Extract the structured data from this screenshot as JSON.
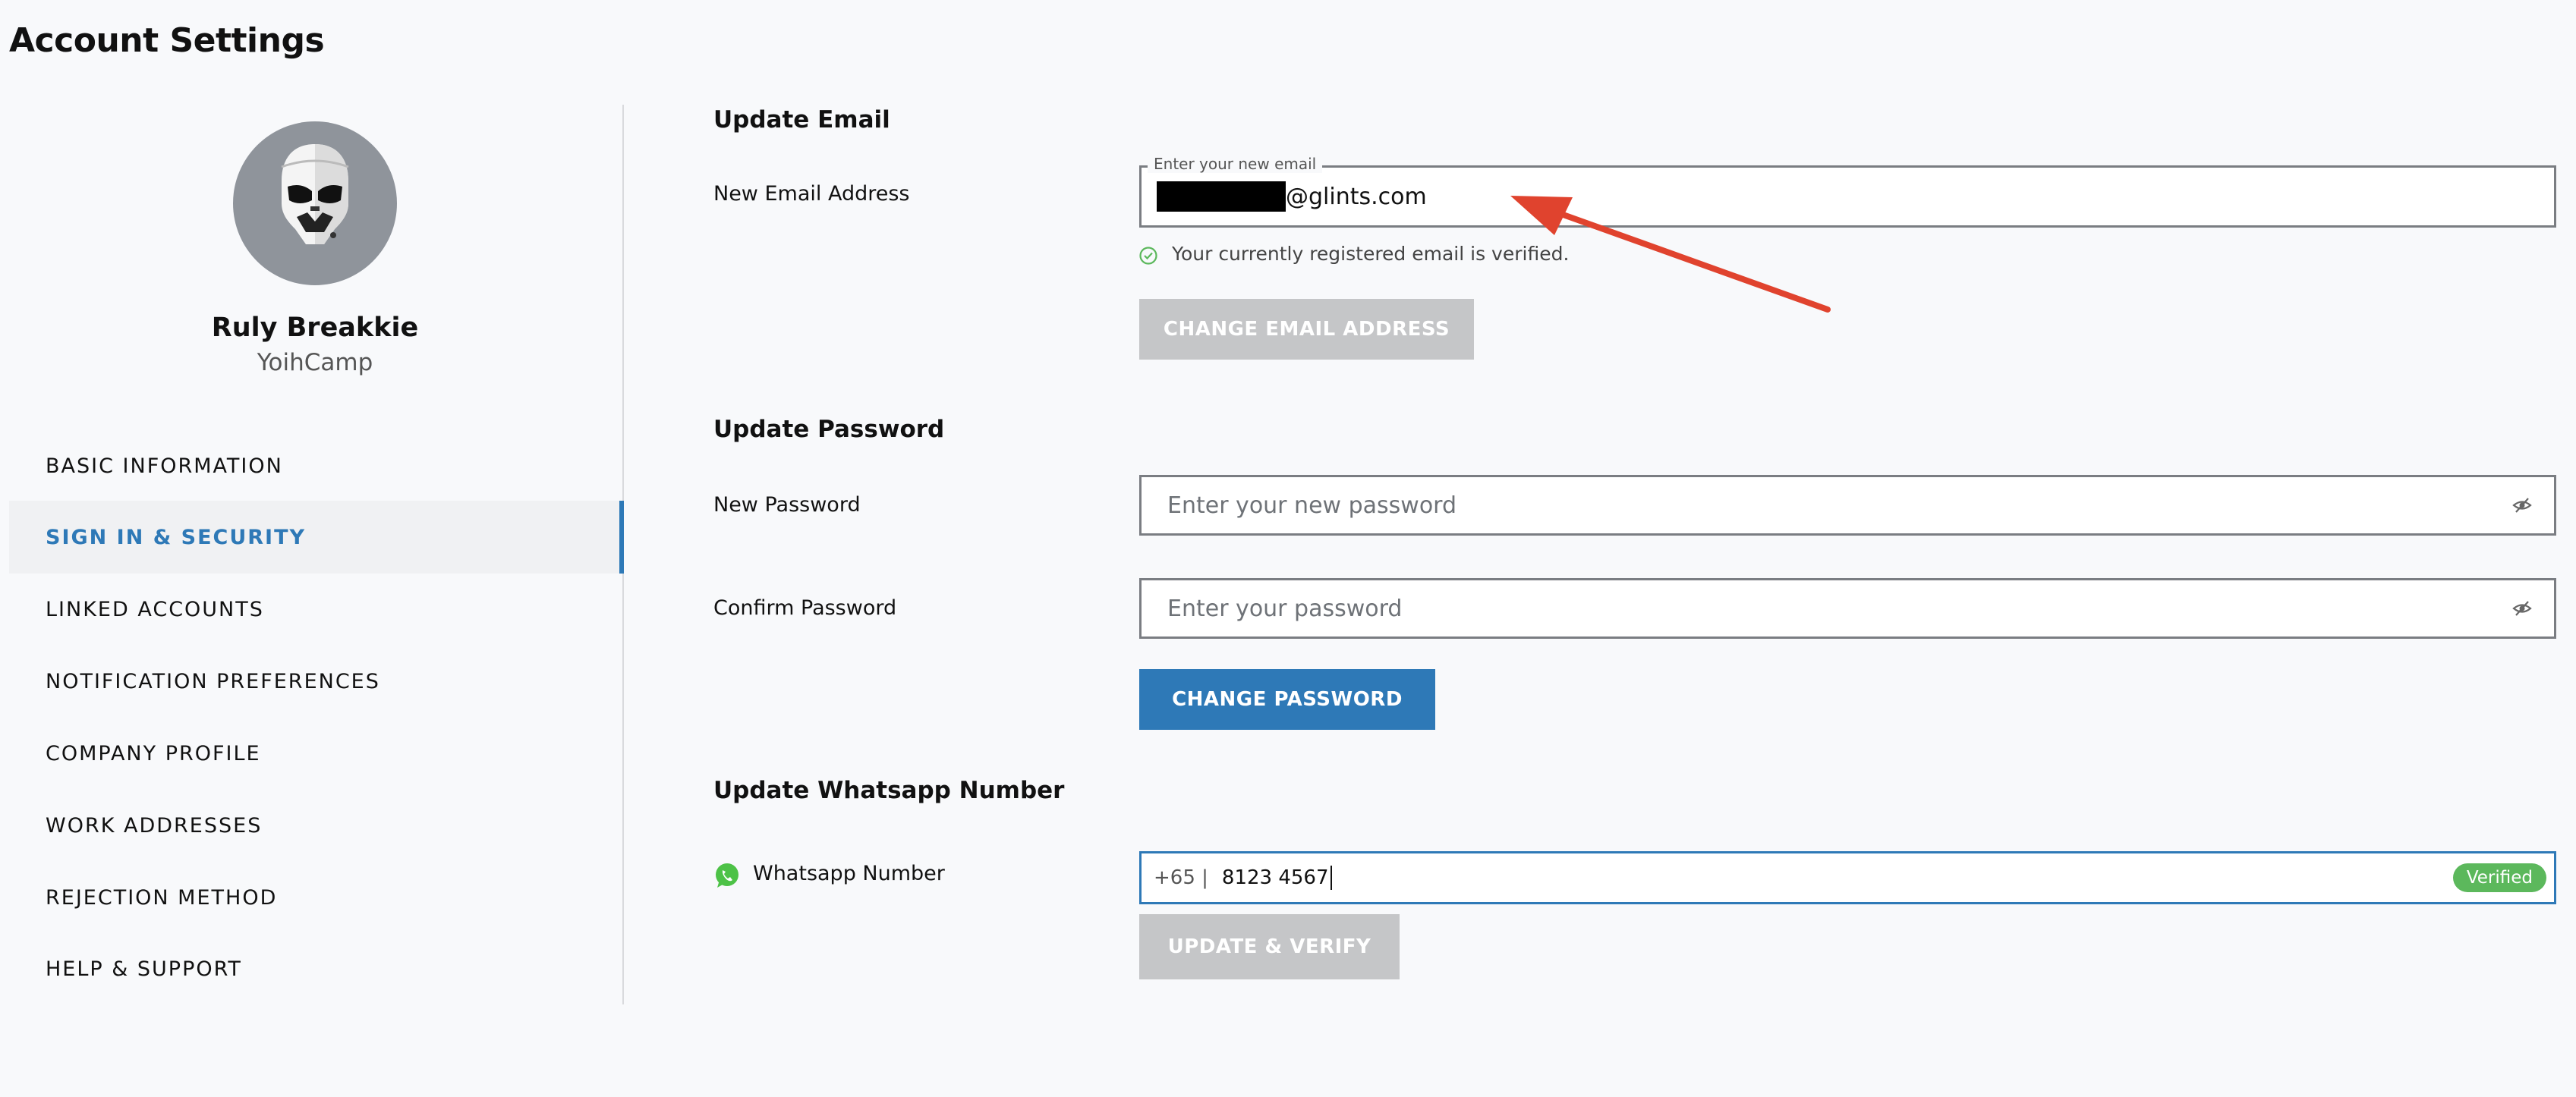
{
  "page": {
    "title": "Account Settings"
  },
  "profile": {
    "name": "Ruly Breakkie",
    "company": "YoihCamp"
  },
  "sidebar": {
    "items": [
      {
        "label": "BASIC INFORMATION",
        "active": false
      },
      {
        "label": "SIGN IN & SECURITY",
        "active": true
      },
      {
        "label": "LINKED ACCOUNTS",
        "active": false
      },
      {
        "label": "NOTIFICATION PREFERENCES",
        "active": false
      },
      {
        "label": "COMPANY PROFILE",
        "active": false
      },
      {
        "label": "WORK ADDRESSES",
        "active": false
      },
      {
        "label": "REJECTION METHOD",
        "active": false
      },
      {
        "label": "HELP & SUPPORT",
        "active": false
      }
    ]
  },
  "email": {
    "section_title": "Update Email",
    "label": "New Email Address",
    "legend": "Enter your new email",
    "value_suffix": "@glints.com",
    "verified_note": "Your currently registered email is verified.",
    "button": "CHANGE EMAIL ADDRESS"
  },
  "password": {
    "section_title": "Update Password",
    "new_label": "New Password",
    "new_placeholder": "Enter your new password",
    "confirm_label": "Confirm Password",
    "confirm_placeholder": "Enter your password",
    "button": "CHANGE PASSWORD"
  },
  "whatsapp": {
    "section_title": "Update Whatsapp Number",
    "label": "Whatsapp Number",
    "country_code": "+65 |",
    "number": "8123 4567",
    "badge": "Verified",
    "button": "UPDATE & VERIFY"
  },
  "colors": {
    "accent": "#2e79b7",
    "disabled": "#c5c6c8",
    "verified_green": "#5cb85c",
    "arrow_red": "#e0432e",
    "whatsapp_green": "#4dc247"
  },
  "icons": [
    "check-circle-icon",
    "eye-slash-icon",
    "whatsapp-icon",
    "arrow-annotation"
  ]
}
